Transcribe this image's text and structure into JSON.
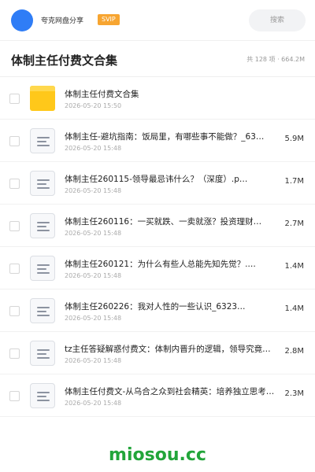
{
  "header": {
    "share_name": "夸克网盘分享",
    "svip_badge": "SVIP",
    "search_label": "搜索"
  },
  "folder": {
    "title": "体制主任付费文合集",
    "meta": "共 128 项 · 664.2M"
  },
  "files": [
    {
      "type": "folder",
      "icon": "folder-icon",
      "name": "体制主任付费文合集",
      "date": "2026-05-20 15:50",
      "size": ""
    },
    {
      "type": "doc",
      "icon": "document-icon",
      "name": "体制主任-避坑指南：饭局里，有哪些事不能做？_63…",
      "date": "2026-05-20 15:48",
      "size": "5.9M"
    },
    {
      "type": "doc",
      "icon": "document-icon",
      "name": "体制主任260115-领导最忌讳什么？（深度）.p…",
      "date": "2026-05-20 15:48",
      "size": "1.7M"
    },
    {
      "type": "doc",
      "icon": "document-icon",
      "name": "体制主任260116：一买就跌、一卖就涨？投资理财…",
      "date": "2026-05-20 15:48",
      "size": "2.7M"
    },
    {
      "type": "doc",
      "icon": "document-icon",
      "name": "体制主任260121：为什么有些人总能先知先觉？.…",
      "date": "2026-05-20 15:48",
      "size": "1.4M"
    },
    {
      "type": "doc",
      "icon": "document-icon",
      "name": "体制主任260226：我对人性的一些认识_6323…",
      "date": "2026-05-20 15:48",
      "size": "1.4M"
    },
    {
      "type": "doc",
      "icon": "document-icon",
      "name": "tz主任答疑解惑付费文：体制内晋升的逻辑，领导究竟…",
      "date": "2026-05-20 15:48",
      "size": "2.8M"
    },
    {
      "type": "doc",
      "icon": "document-icon",
      "name": "体制主任付费文-从乌合之众到社会精英：培养独立思考…",
      "date": "2026-05-20 15:48",
      "size": "2.3M"
    }
  ],
  "watermark": "miosou.cc",
  "colors": {
    "accent_blue": "#2f7df6",
    "svip_orange": "#f7a531",
    "folder_yellow": "#ffc81a",
    "watermark_green": "#22a53a"
  }
}
